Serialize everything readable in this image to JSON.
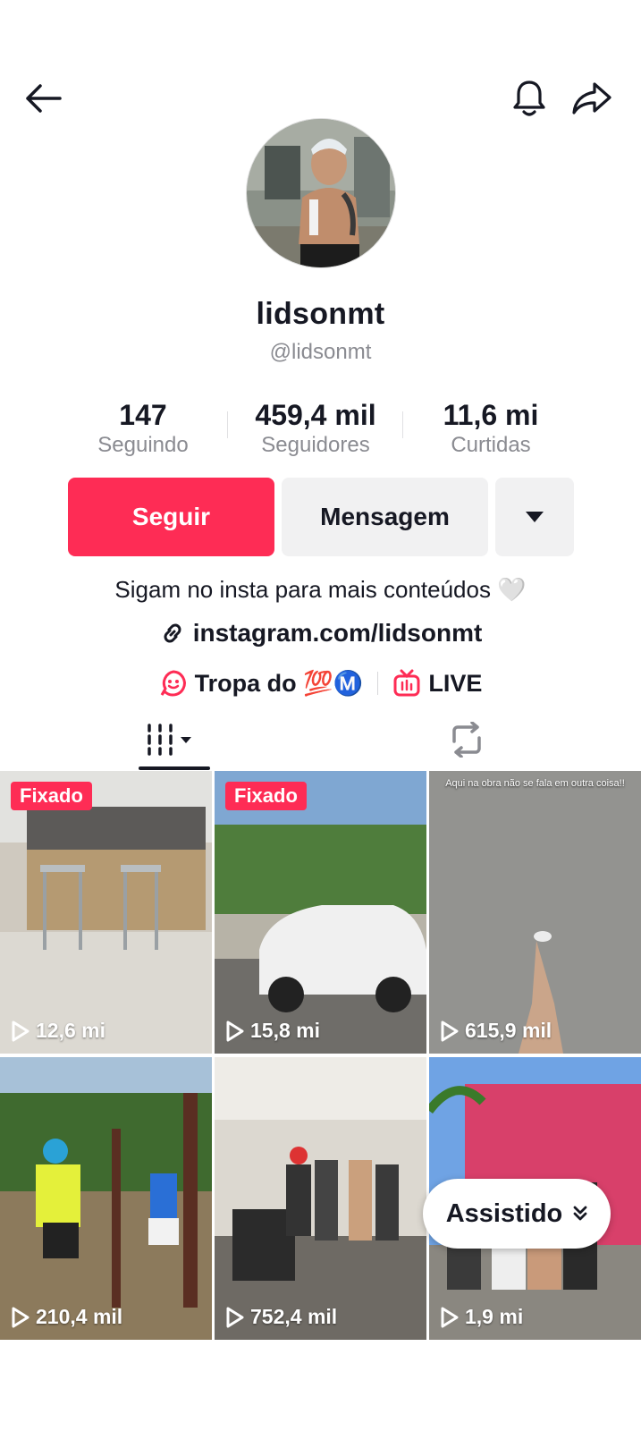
{
  "header": {
    "back_icon": "arrow-left-icon",
    "notification_icon": "bell-icon",
    "share_icon": "share-arrow-icon"
  },
  "profile": {
    "display_name": "lidsonmt",
    "handle": "@lidsonmt",
    "stats": [
      {
        "value": "147",
        "label": "Seguindo"
      },
      {
        "value": "459,4 mil",
        "label": "Seguidores"
      },
      {
        "value": "11,6 mi",
        "label": "Curtidas"
      }
    ],
    "bio": "Sigam no insta para mais conteúdos 🤍",
    "link": "instagram.com/lidsonmt"
  },
  "actions": {
    "follow_label": "Seguir",
    "message_label": "Mensagem"
  },
  "extras": {
    "group_label": "Tropa do 💯Ⓜ️",
    "live_label": "LIVE"
  },
  "videos": [
    {
      "views": "12,6 mi",
      "pinned": "Fixado",
      "caption": ""
    },
    {
      "views": "15,8 mi",
      "pinned": "Fixado",
      "caption": ""
    },
    {
      "views": "615,9 mil",
      "pinned": "",
      "caption": "Aqui na obra não se fala em outra coisa!!"
    },
    {
      "views": "210,4 mil",
      "pinned": "",
      "caption": ""
    },
    {
      "views": "752,4 mil",
      "pinned": "",
      "caption": ""
    },
    {
      "views": "1,9 mi",
      "pinned": "",
      "caption": ""
    }
  ],
  "watched_button": {
    "label": "Assistido"
  },
  "colors": {
    "accent": "#fe2c55",
    "text": "#161823",
    "muted": "#8a8b91",
    "button_gray": "#f1f1f2"
  }
}
